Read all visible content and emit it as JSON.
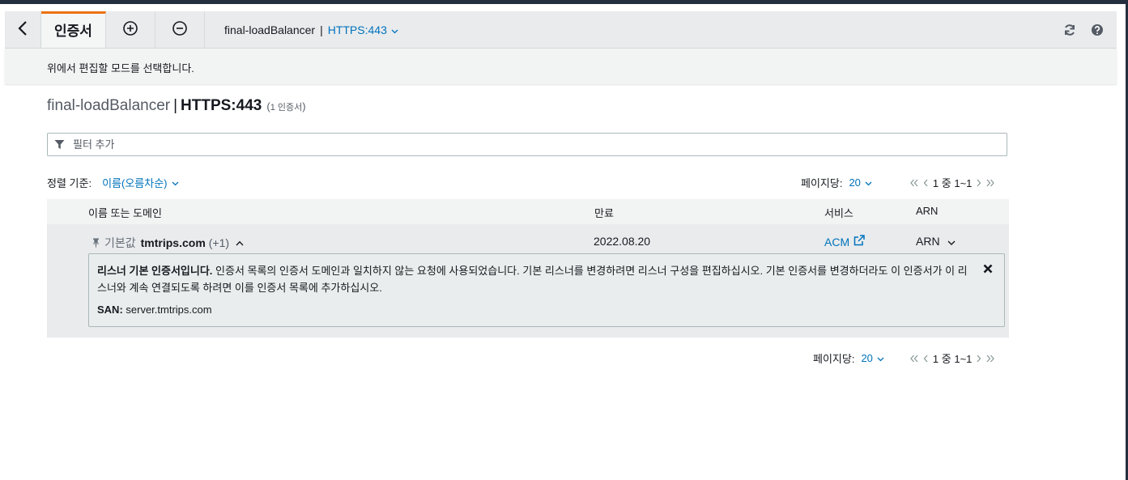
{
  "toolbar": {
    "tab_label": "인증서",
    "lb_name": "final-loadBalancer",
    "separator": "|",
    "listener": "HTTPS:443"
  },
  "info_message": "위에서 편집할 모드를 선택합니다.",
  "heading": {
    "lb_name": "final-loadBalancer",
    "separator": "|",
    "listener": "HTTPS:443",
    "count_open": "(",
    "count_text": "1 인증서",
    "count_close": ")"
  },
  "filter": {
    "placeholder": "필터 추가"
  },
  "sort": {
    "label": "정렬 기준:",
    "value": "이름(오름차순)"
  },
  "pagination": {
    "per_page_label": "페이지당:",
    "per_page_value": "20",
    "range": "1 중 1~1"
  },
  "table": {
    "columns": [
      "이름 또는 도메인",
      "만료",
      "서비스",
      "ARN"
    ],
    "rows": [
      {
        "default_tag": "기본값",
        "domain": "tmtrips.com",
        "more": "(+1)",
        "expiry": "2022.08.20",
        "service": "ACM",
        "arn": "ARN",
        "detail": {
          "bold_lead": "리스너 기본 인증서입니다.",
          "message": " 인증서 목록의 인증서 도메인과 일치하지 않는 요청에 사용되었습니다. 기본 리스너를 변경하려면 리스너 구성을 편집하십시오. 기본 인증서를 변경하더라도 이 인증서가 이 리스너와 계속 연결되도록 하려면 이를 인증서 목록에 추가하십시오.",
          "san_label": "SAN:",
          "san_value": " server.tmtrips.com"
        }
      }
    ]
  },
  "colors": {
    "accent": "#ec7211",
    "link": "#0073bb",
    "header_dark": "#232f3e"
  },
  "icons": [
    "chevron-left-icon",
    "add-circle-icon",
    "remove-circle-icon",
    "chevron-down-icon",
    "refresh-icon",
    "help-icon",
    "filter-icon",
    "pin-icon",
    "chevron-up-icon",
    "external-link-icon",
    "close-icon",
    "first-page-icon",
    "prev-page-icon",
    "next-page-icon",
    "last-page-icon"
  ]
}
